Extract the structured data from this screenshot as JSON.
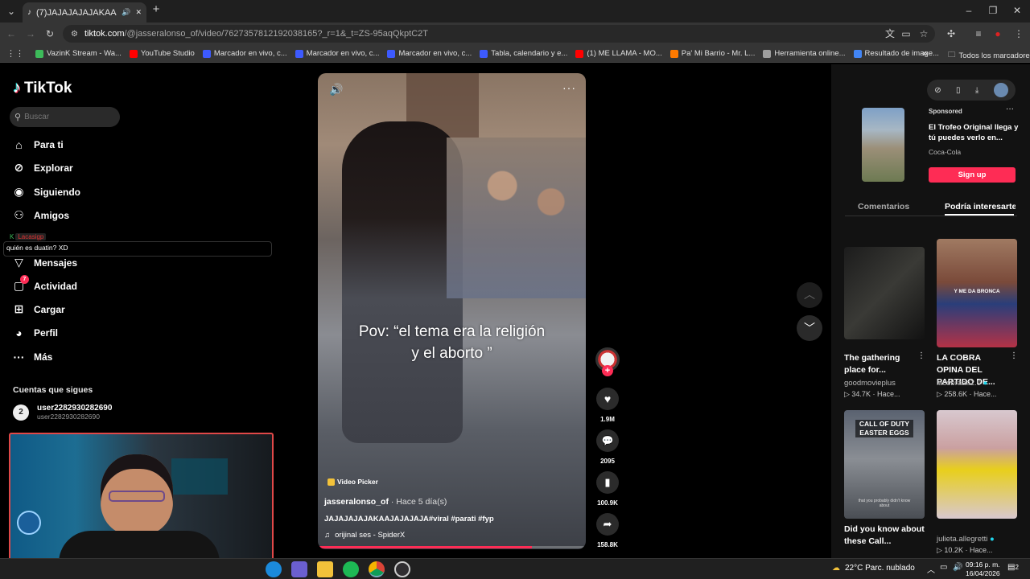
{
  "browser": {
    "tab_title": "(7)JAJAJAJAJAKAAJAJAJA",
    "tab_close": "✕",
    "new_tab": "+",
    "url_host": "tiktok.com",
    "url_path": "/@jasseralonso_of/video/7627357812192038165?_r=1&_t=ZS-95aqQkptC2T",
    "bookmarks": [
      {
        "label": "VazinK Stream - Wa...",
        "color": "#3dbb5a"
      },
      {
        "label": "YouTube Studio",
        "color": "#ff0000"
      },
      {
        "label": "Marcador en vivo, c...",
        "color": "#3d5afe"
      },
      {
        "label": "Marcador en vivo, c...",
        "color": "#3d5afe"
      },
      {
        "label": "Marcador en vivo, c...",
        "color": "#3d5afe"
      },
      {
        "label": "Tabla, calendario y e...",
        "color": "#3d5afe"
      },
      {
        "label": "(1) ME LLAMA - MO...",
        "color": "#ff0000"
      },
      {
        "label": "Pa' Mi Barrio - Mr. L...",
        "color": "#ff7a00"
      },
      {
        "label": "Herramienta online...",
        "color": "#9e9e9e"
      },
      {
        "label": "Resultado de image...",
        "color": "#4285f4"
      }
    ],
    "bookmarks_more": "»",
    "all_bookmarks": "Todos los marcadores"
  },
  "tiktok": {
    "logo": "TikTok",
    "search_placeholder": "Buscar",
    "nav": [
      {
        "label": "Para ti",
        "icon": "home-icon"
      },
      {
        "label": "Explorar",
        "icon": "compass-icon"
      },
      {
        "label": "Siguiendo",
        "icon": "following-icon"
      },
      {
        "label": "Amigos",
        "icon": "friends-icon"
      },
      {
        "label": "Mensajes",
        "icon": "messages-icon"
      },
      {
        "label": "Actividad",
        "icon": "activity-icon"
      },
      {
        "label": "Cargar",
        "icon": "upload-icon"
      },
      {
        "label": "Perfil",
        "icon": "profile-icon"
      },
      {
        "label": "Más",
        "icon": "more-icon"
      }
    ],
    "activity_badge": "7",
    "chat_overlay_user": "Lacasigp",
    "chat_overlay_text": "quién es duatin? XD",
    "following_title": "Cuentas que sigues",
    "following": [
      {
        "name": "user2282930282690",
        "handle": "user2282930282690"
      }
    ],
    "video": {
      "caption_line1": "Pov: “el tema era la religión",
      "caption_line2": "y el aborto ”",
      "tag": "Video Picker",
      "author": "jasseralonso_of",
      "time": "· Hace 5 día(s)",
      "description": "JAJAJAJAJAKAAJAJAJAJA#viral #parati #fyp",
      "sound": "orijinal ses - SpiderX"
    },
    "actions": {
      "likes": "1.9M",
      "comments": "2095",
      "saves": "100.9K",
      "shares": "158.8K"
    },
    "ad": {
      "sponsored": "Sponsored",
      "title": "El Trofeo Original llega y tú puedes verlo en...",
      "brand": "Coca-Cola",
      "cta": "Sign up"
    },
    "tabs": {
      "comments": "Comentarios",
      "suggested": "Podría interesarte"
    },
    "suggestions": [
      {
        "title": "The gathering place for...",
        "user": "goodmovieplus",
        "stats": "34.7K · Hace...",
        "verified": false
      },
      {
        "title": "LA COBRA OPINA DEL PARTIDO DE...",
        "user": "lacobraaa2.0",
        "stats": "258.6K · Hace...",
        "verified": true,
        "thumb_text": "Y ME DA BRONCA"
      },
      {
        "title": "Did you know about these Call...",
        "user": "",
        "stats": "",
        "verified": false,
        "thumb_text": "CALL OF DUTY EASTER EGGS",
        "thumb_sub": "that you probably didn't know about"
      },
      {
        "title": "",
        "user": "julieta.allegretti",
        "stats": "10.2K · Hace...",
        "verified": true
      }
    ]
  },
  "taskbar": {
    "weather": "22°C Parc. nublado",
    "time": "09:16 p. m.",
    "date": "16/04/2026",
    "notif": "2"
  }
}
